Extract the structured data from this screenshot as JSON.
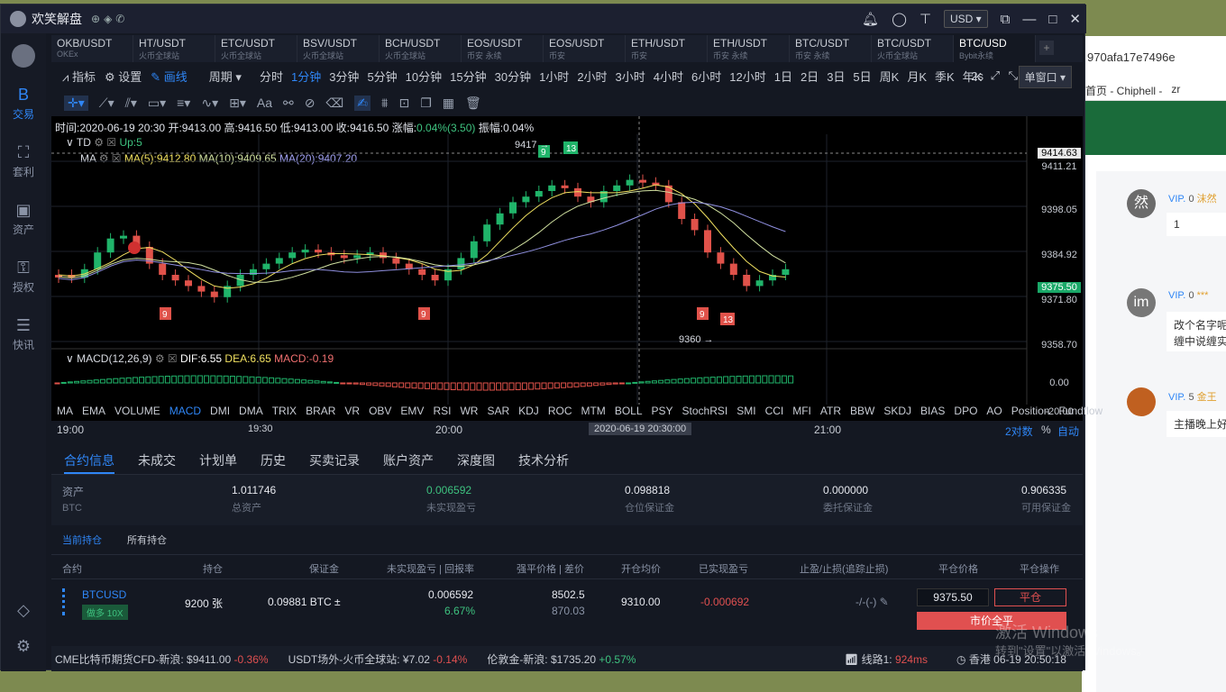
{
  "bg": {
    "url_text": "970afa17e7496e",
    "bookmarks": [
      "首页 - Chiphell -",
      "zr"
    ],
    "messages": [
      {
        "avatar": "然",
        "vip": "0",
        "name": "沫然",
        "text": "1"
      },
      {
        "avatar": "im",
        "vip": "0",
        "name": "***",
        "text": "改个名字呢",
        "text2": "缠中说缠实"
      },
      {
        "avatar": "",
        "vip": "5",
        "name": "金王",
        "text": "主播晚上好"
      }
    ]
  },
  "app": {
    "title": "欢笑解盘",
    "currency": "USD"
  },
  "sidebar": [
    {
      "label": "交易",
      "icon": "B"
    },
    {
      "label": "套利",
      "icon": "⛶"
    },
    {
      "label": "资产",
      "icon": "▣"
    },
    {
      "label": "授权",
      "icon": "⚿"
    },
    {
      "label": "快讯",
      "icon": "☰"
    }
  ],
  "tabs": [
    {
      "pair": "OKB/USDT",
      "venue": "OKEx"
    },
    {
      "pair": "HT/USDT",
      "venue": "火币全球站"
    },
    {
      "pair": "ETC/USDT",
      "venue": "火币全球站"
    },
    {
      "pair": "BSV/USDT",
      "venue": "火币全球站"
    },
    {
      "pair": "BCH/USDT",
      "venue": "火币全球站"
    },
    {
      "pair": "EOS/USDT",
      "venue": "币安 永续"
    },
    {
      "pair": "EOS/USDT",
      "venue": "币安"
    },
    {
      "pair": "ETH/USDT",
      "venue": "币安"
    },
    {
      "pair": "ETH/USDT",
      "venue": "币安 永续"
    },
    {
      "pair": "BTC/USDT",
      "venue": "币安 永续"
    },
    {
      "pair": "BTC/USDT",
      "venue": "火币全球站"
    },
    {
      "pair": "BTC/USD",
      "venue": "Bybit永续"
    }
  ],
  "toolbar": {
    "indicator": "指标",
    "settings": "设置",
    "draw": "画线",
    "period": "周期",
    "periods": [
      "分时",
      "1分钟",
      "3分钟",
      "5分钟",
      "10分钟",
      "15分钟",
      "30分钟",
      "1小时",
      "2小时",
      "3小时",
      "4小时",
      "6小时",
      "12小时",
      "1日",
      "2日",
      "3日",
      "5日",
      "周K",
      "月K",
      "季K",
      "年K"
    ],
    "selected_period": "1分钟",
    "refresh": "2s",
    "window": "单窗口"
  },
  "chart": {
    "info": {
      "time": "时间:2020-06-19 20:30",
      "open": "开:9413.00",
      "high": "高:9416.50",
      "low": "低:9413.00",
      "close": "收:9416.50",
      "change_label": "涨幅:",
      "change": "0.04%(3.50)",
      "amp": "振幅:0.04%"
    },
    "td": {
      "name": "TD",
      "param": "Up:5"
    },
    "ma": {
      "name": "MA",
      "ma5": "MA(5):9412.80",
      "ma10": "MA(10):9409.65",
      "ma20": "MA(20):9407.20"
    },
    "macd": {
      "name": "MACD(12,26,9)",
      "dif": "DIF:6.55",
      "dea": "DEA:6.65",
      "macd": "MACD:-0.19"
    },
    "price_axis": [
      "9411.21",
      "9398.05",
      "9384.92",
      "9371.80",
      "9358.70"
    ],
    "current_price": "9414.63",
    "last_price": "9375.50",
    "macd_axis": [
      "0.00",
      "-20.00"
    ],
    "high_mark": "9417",
    "low_mark": "9360",
    "indicators": [
      "MA",
      "EMA",
      "VOLUME",
      "MACD",
      "DMI",
      "DMA",
      "TRIX",
      "BRAR",
      "VR",
      "OBV",
      "EMV",
      "RSI",
      "WR",
      "SAR",
      "KDJ",
      "ROC",
      "MTM",
      "BOLL",
      "PSY",
      "StochRSI",
      "SMI",
      "CCI",
      "MFI",
      "ATR",
      "BBW",
      "SKDJ",
      "BIAS",
      "DPO",
      "AO",
      "Position",
      "Fundflow"
    ],
    "selected_indicator": "MACD",
    "time_axis": [
      "19:00",
      "19:30",
      "20:00",
      "21:00"
    ],
    "crosshair_time": "2020-06-19 20:30:00",
    "scale_opts": [
      "2对数",
      "%",
      "自动"
    ]
  },
  "bottom": {
    "tabs": [
      "合约信息",
      "未成交",
      "计划单",
      "历史",
      "买卖记录",
      "账户资产",
      "深度图",
      "技术分析"
    ],
    "account": [
      {
        "value": "资产",
        "label": "BTC"
      },
      {
        "value": "1.011746",
        "label": "总资产"
      },
      {
        "value": "0.006592",
        "label": "未实现盈亏"
      },
      {
        "value": "0.098818",
        "label": "仓位保证金"
      },
      {
        "value": "0.000000",
        "label": "委托保证金"
      },
      {
        "value": "0.906335",
        "label": "可用保证金"
      }
    ],
    "subtabs": [
      "当前持仓",
      "所有持仓"
    ],
    "headers": [
      "合约",
      "持仓",
      "保证金",
      "未实现盈亏 | 回报率",
      "强平价格 | 差价",
      "开仓均价",
      "已实现盈亏",
      "止盈/止损(追踪止损)",
      "平仓价格",
      "平仓操作"
    ],
    "position": {
      "symbol": "BTCUSD",
      "side": "做多 10X",
      "qty": "9200 张",
      "margin": "0.09881 BTC ±",
      "upnl": "0.006592",
      "roe": "6.67%",
      "liq": "8502.5",
      "diff": "870.03",
      "entry": "9310.00",
      "rpnl": "-0.000692",
      "tpsl": "-/-(-)",
      "close_price": "9375.50",
      "close_btn": "平仓",
      "market_close": "市价全平"
    }
  },
  "status": {
    "t1": "CME比特币期货CFD-新浪:",
    "v1": "$9411.00",
    "c1": "-0.36%",
    "t2": "USDT场外-火币全球站:",
    "v2": "¥7.02",
    "c2": "-0.14%",
    "t3": "伦敦金-新浪:",
    "v3": "$1735.20",
    "c3": "+0.57%",
    "line": "线路1:",
    "latency": "924ms",
    "clock": "香港 06-19 20:50:18"
  },
  "watermark": {
    "line1": "激活 Windows",
    "line2": "转到\"设置\"以激活 Windows。"
  }
}
